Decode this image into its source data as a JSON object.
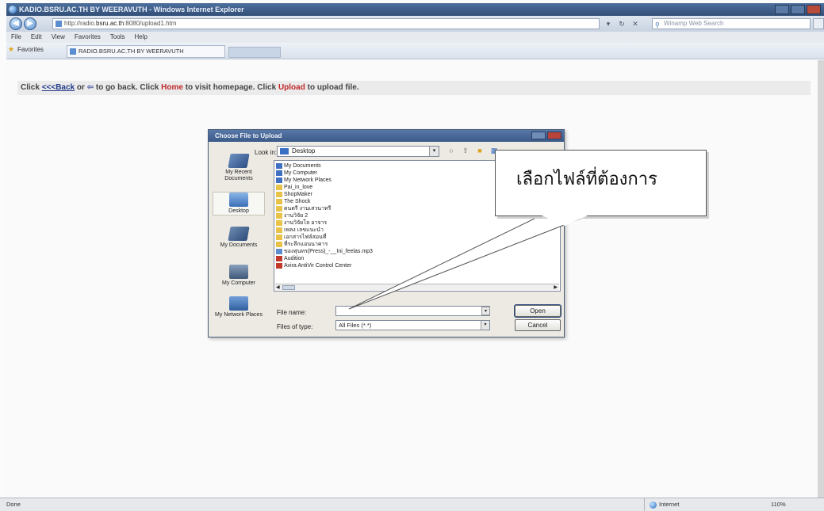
{
  "window": {
    "title": "KADIO.BSRU.AC.TH BY WEERAVUTH - Windows Internet Explorer"
  },
  "address_bar": {
    "url_prefix": "http://radio.",
    "url_host": "bsru.ac.th",
    "url_suffix": ":8080/upload1.htm",
    "search_placeholder": "Winamp Web Search"
  },
  "menu": {
    "items": [
      "File",
      "Edit",
      "View",
      "Favorites",
      "Tools",
      "Help"
    ]
  },
  "favorites_bar": {
    "label": "Favorites",
    "tab_title": "RADIO.BSRU.AC.TH BY WEERAVUTH"
  },
  "page": {
    "info": {
      "click_1": "Click",
      "back_link": "<<<Back",
      "or_text": "or",
      "arrow": "⇦",
      "go_back": "to go back. Click",
      "home": "Home",
      "visit": "to visit homepage. Click",
      "upload": "Upload",
      "to_upload": "to upload file."
    }
  },
  "dialog": {
    "title": "Choose File to Upload",
    "look_in_label": "Look in:",
    "look_in_value": "Desktop",
    "places": [
      {
        "label": "My Recent Documents",
        "icon": "recent-docs-icon"
      },
      {
        "label": "Desktop",
        "icon": "desktop-icon"
      },
      {
        "label": "My Documents",
        "icon": "my-documents-icon"
      },
      {
        "label": "My Computer",
        "icon": "my-computer-icon"
      },
      {
        "label": "My Network Places",
        "icon": "network-places-icon"
      }
    ],
    "files": [
      {
        "name": "My Documents",
        "kind": "system"
      },
      {
        "name": "My Computer",
        "kind": "system"
      },
      {
        "name": "My Network Places",
        "kind": "system"
      },
      {
        "name": "Pai_in_love",
        "kind": "folder"
      },
      {
        "name": "ShopMaker",
        "kind": "folder"
      },
      {
        "name": "The Shock",
        "kind": "folder"
      },
      {
        "name": "ดนตรี งานเสวนาทรี",
        "kind": "folder"
      },
      {
        "name": "งานวิจัย 2",
        "kind": "folder"
      },
      {
        "name": "งานวิจัยโล อาจาร",
        "kind": "folder"
      },
      {
        "name": "เพลง เลขแนะนำ",
        "kind": "folder"
      },
      {
        "name": "เอกสารไฟล์สอนที่",
        "kind": "folder"
      },
      {
        "name": "ที่ระลึกแอนนาคาร",
        "kind": "folder"
      },
      {
        "name": "ของสุนทร(Press)_-__Ini_feelas.mp3",
        "kind": "mp3"
      },
      {
        "name": "Audition",
        "kind": "app"
      },
      {
        "name": "Avira AntiVir Control Center",
        "kind": "app"
      }
    ],
    "file_name_label": "File name:",
    "file_name_value": "",
    "file_type_label": "Files of type:",
    "file_type_value": "All Files (*.*)",
    "open_button": "Open",
    "cancel_button": "Cancel"
  },
  "callout": {
    "text": "เลือกไฟล์ที่ต้องการ"
  },
  "status_bar": {
    "status": "Done",
    "zone": "Internet",
    "zoom": "110%"
  }
}
